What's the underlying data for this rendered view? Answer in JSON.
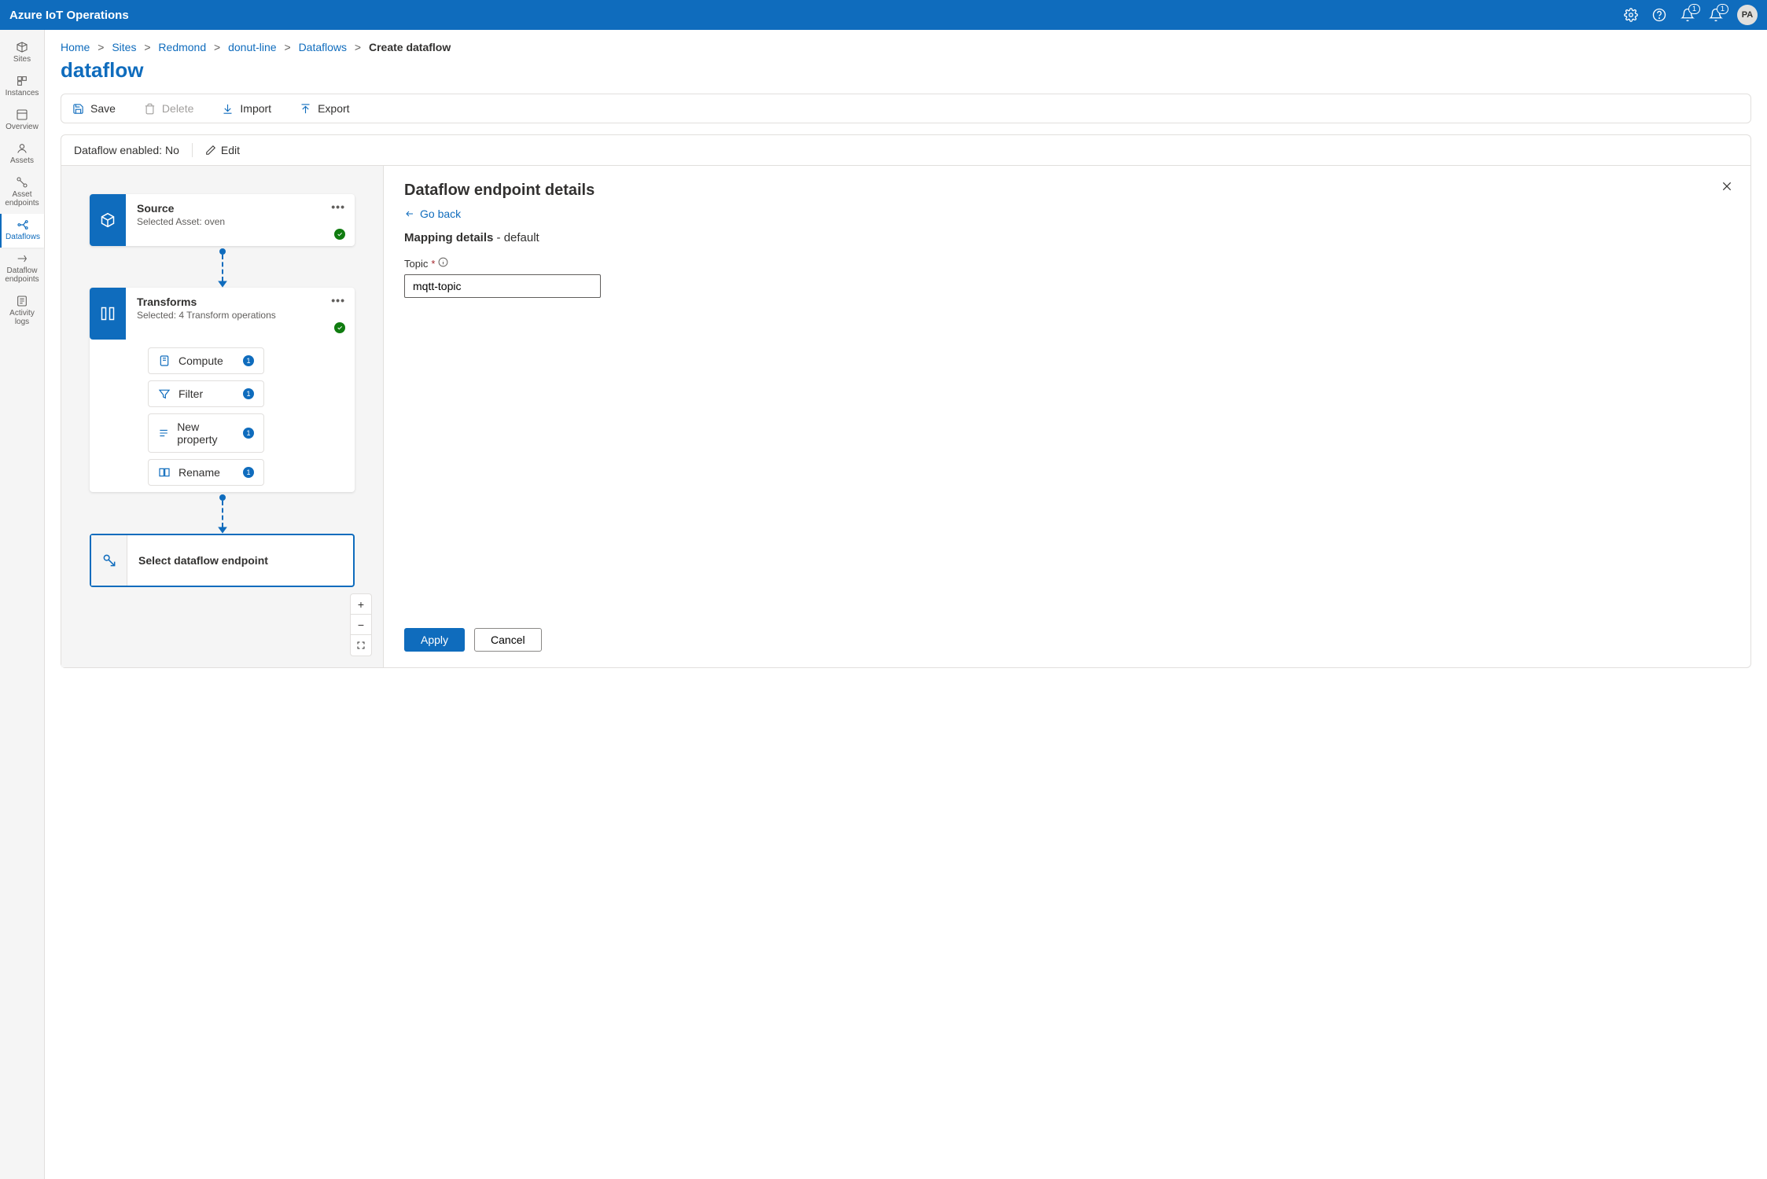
{
  "header": {
    "app_title": "Azure IoT Operations",
    "avatar_initials": "PA",
    "notification_badge_1": "1",
    "notification_badge_2": "1"
  },
  "sidebar": {
    "items": [
      {
        "label": "Sites"
      },
      {
        "label": "Instances"
      },
      {
        "label": "Overview"
      },
      {
        "label": "Assets"
      },
      {
        "label": "Asset endpoints"
      },
      {
        "label": "Dataflows"
      },
      {
        "label": "Dataflow endpoints"
      },
      {
        "label": "Activity logs"
      }
    ]
  },
  "breadcrumbs": {
    "home": "Home",
    "sites": "Sites",
    "redmond": "Redmond",
    "cluster": "donut-line",
    "dataflows": "Dataflows",
    "current": "Create dataflow"
  },
  "page": {
    "title": "dataflow"
  },
  "commands": {
    "save": "Save",
    "delete": "Delete",
    "import": "Import",
    "export": "Export"
  },
  "status": {
    "enabled_text": "Dataflow enabled: No",
    "edit": "Edit"
  },
  "nodes": {
    "source": {
      "title": "Source",
      "sub": "Selected Asset: oven"
    },
    "transforms": {
      "title": "Transforms",
      "sub": "Selected: 4 Transform operations"
    },
    "transform_items": {
      "compute": "Compute",
      "filter": "Filter",
      "newprop": "New property",
      "rename": "Rename",
      "count": "1"
    },
    "endpoint": {
      "label": "Select dataflow endpoint"
    }
  },
  "details": {
    "title": "Dataflow endpoint details",
    "go_back": "Go back",
    "mapping_label": "Mapping details",
    "mapping_value": "default",
    "topic_label": "Topic",
    "topic_value": "mqtt-topic",
    "apply": "Apply",
    "cancel": "Cancel"
  },
  "zoom": {
    "in": "+",
    "out": "−"
  }
}
